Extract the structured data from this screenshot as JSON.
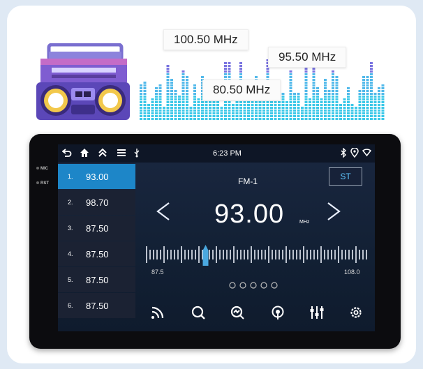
{
  "promo": {
    "freq_labels": [
      "100.50 MHz",
      "95.50 MHz",
      "80.50 MHz"
    ]
  },
  "device": {
    "side_labels": [
      "MIC",
      "RST"
    ],
    "status": {
      "time": "6:23 PM",
      "left_icons": [
        "back-icon",
        "home-icon",
        "double-chevron-up-icon",
        "menu-icon",
        "usb-icon"
      ],
      "right_icons": [
        "bluetooth-icon",
        "location-icon",
        "wifi-icon"
      ]
    },
    "presets": [
      {
        "num": "1.",
        "freq": "93.00",
        "active": true
      },
      {
        "num": "2.",
        "freq": "98.70",
        "active": false
      },
      {
        "num": "3.",
        "freq": "87.50",
        "active": false
      },
      {
        "num": "4.",
        "freq": "87.50",
        "active": false
      },
      {
        "num": "5.",
        "freq": "87.50",
        "active": false
      },
      {
        "num": "6.",
        "freq": "87.50",
        "active": false
      }
    ],
    "radio": {
      "band": "FM-1",
      "st_label": "ST",
      "frequency": "93.00",
      "unit": "MHz",
      "scale_min": "87.5",
      "scale_max": "108.0",
      "tuned_value": 93.0
    },
    "toolbar_icons": [
      "signal-icon",
      "search-icon",
      "auto-scan-icon",
      "broadcast-icon",
      "equalizer-icon",
      "settings-icon"
    ],
    "colors": {
      "accent": "#1d86c8",
      "st_text": "#5fc6ff"
    }
  }
}
